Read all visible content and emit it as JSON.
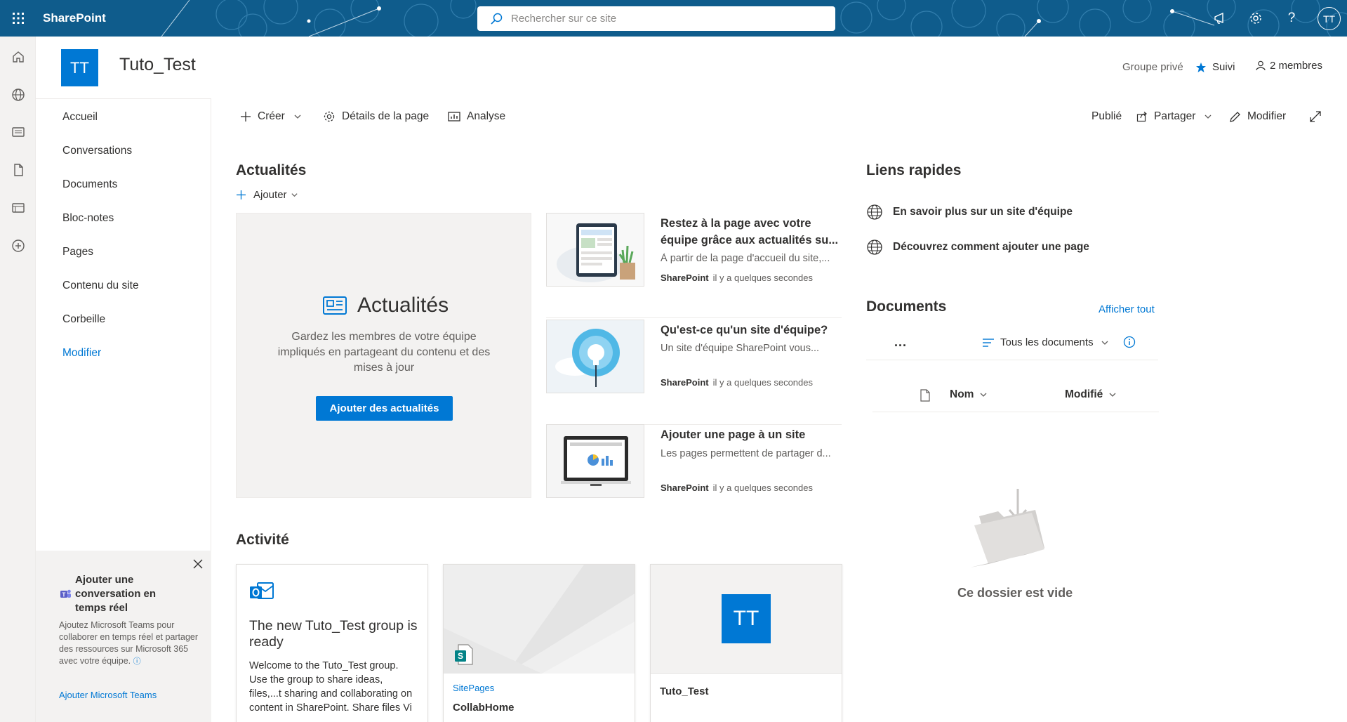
{
  "suite": {
    "brand": "SharePoint",
    "search_placeholder": "Rechercher sur ce site",
    "user_initials": "TT"
  },
  "site": {
    "logo_initials": "TT",
    "title": "Tuto_Test",
    "privacy": "Groupe privé",
    "follow_label": "Suivi",
    "members_label": "2 membres"
  },
  "nav": {
    "items": [
      "Accueil",
      "Conversations",
      "Documents",
      "Bloc-notes",
      "Pages",
      "Contenu du site",
      "Corbeille",
      "Modifier"
    ]
  },
  "teams_promo": {
    "title": "Ajouter une conversation en temps réel",
    "text": "Ajoutez Microsoft Teams pour collaborer en temps réel et partager des ressources sur Microsoft 365 avec votre équipe.",
    "link": "Ajouter Microsoft Teams"
  },
  "commands": {
    "create": "Créer",
    "page_details": "Détails de la page",
    "analytics": "Analyse",
    "status": "Publié",
    "share": "Partager",
    "edit": "Modifier"
  },
  "news": {
    "title": "Actualités",
    "add_label": "Ajouter",
    "empty_title": "Actualités",
    "empty_text": "Gardez les membres de votre équipe impliqués en partageant du contenu et des mises à jour",
    "empty_button": "Ajouter des actualités",
    "items": [
      {
        "title": "Restez à la page avec votre équipe grâce aux actualités su...",
        "desc": "À partir de la page d'accueil du site,...",
        "source": "SharePoint",
        "time": "il y a quelques secondes"
      },
      {
        "title": "Qu'est-ce qu'un site d'équipe?",
        "desc": "Un site d'équipe SharePoint vous...",
        "source": "SharePoint",
        "time": "il y a quelques secondes"
      },
      {
        "title": "Ajouter une page à un site",
        "desc": "Les pages permettent de partager d...",
        "source": "SharePoint",
        "time": "il y a quelques secondes"
      }
    ]
  },
  "quick_links": {
    "title": "Liens rapides",
    "items": [
      "En savoir plus sur un site d'équipe",
      "Découvrez comment ajouter une page"
    ]
  },
  "documents": {
    "title": "Documents",
    "see_all": "Afficher tout",
    "more": "...",
    "view": "Tous les documents",
    "col_name": "Nom",
    "col_modified": "Modifié",
    "empty": "Ce dossier est vide"
  },
  "activity": {
    "title": "Activité",
    "cards": [
      {
        "title": "The new Tuto_Test group is ready",
        "text": "Welcome to the Tuto_Test group. Use the group to share ideas, files,...t sharing and collaborating on content in SharePoint. Share files Vi"
      },
      {
        "type": "SitePages",
        "name": "CollabHome"
      },
      {
        "initials": "TT",
        "name": "Tuto_Test"
      }
    ]
  },
  "colors": {
    "suite_bar": "#0f5c8c",
    "accent": "#0078d4",
    "neutral_bg": "#f3f2f1"
  }
}
